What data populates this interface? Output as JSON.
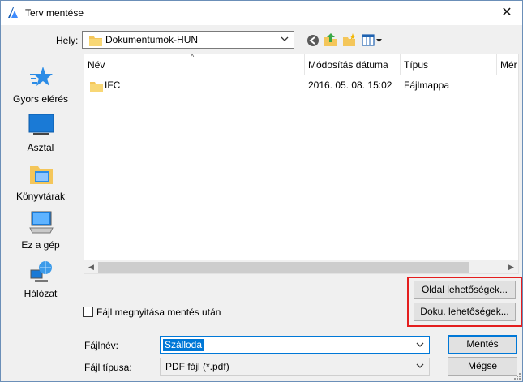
{
  "window": {
    "title": "Terv mentése",
    "close_glyph": "✕"
  },
  "location": {
    "label": "Hely:",
    "value": "Dokumentumok-HUN"
  },
  "toolbar": {
    "icons": [
      "back-icon",
      "up-folder-icon",
      "new-folder-icon",
      "view-menu-icon"
    ]
  },
  "places": [
    {
      "label": "Gyors elérés",
      "icon": "star-icon"
    },
    {
      "label": "Asztal",
      "icon": "desktop-icon"
    },
    {
      "label": "Könyvtárak",
      "icon": "libraries-icon"
    },
    {
      "label": "Ez a gép",
      "icon": "computer-icon"
    },
    {
      "label": "Hálózat",
      "icon": "network-icon"
    }
  ],
  "columns": [
    "Név",
    "Módosítás dátuma",
    "Típus",
    "Mér"
  ],
  "rows": [
    {
      "name": "IFC",
      "modified": "2016. 05. 08. 15:02",
      "type": "Fájlmappa",
      "icon": "folder-icon"
    }
  ],
  "options": {
    "page_options_label": "Oldal lehetőségek...",
    "doc_options_label": "Doku. lehetőségek...",
    "open_after_save_label": "Fájl megnyitása mentés után",
    "open_after_save_checked": false
  },
  "filename": {
    "label": "Fájlnév:",
    "value": "Szálloda"
  },
  "filetype": {
    "label": "Fájl típusa:",
    "value": "PDF fájl (*.pdf)"
  },
  "buttons": {
    "save": "Mentés",
    "cancel": "Mégse"
  },
  "colors": {
    "accent": "#0078d7",
    "highlight_box": "#e41e1e",
    "folder": "#f4c65a"
  }
}
